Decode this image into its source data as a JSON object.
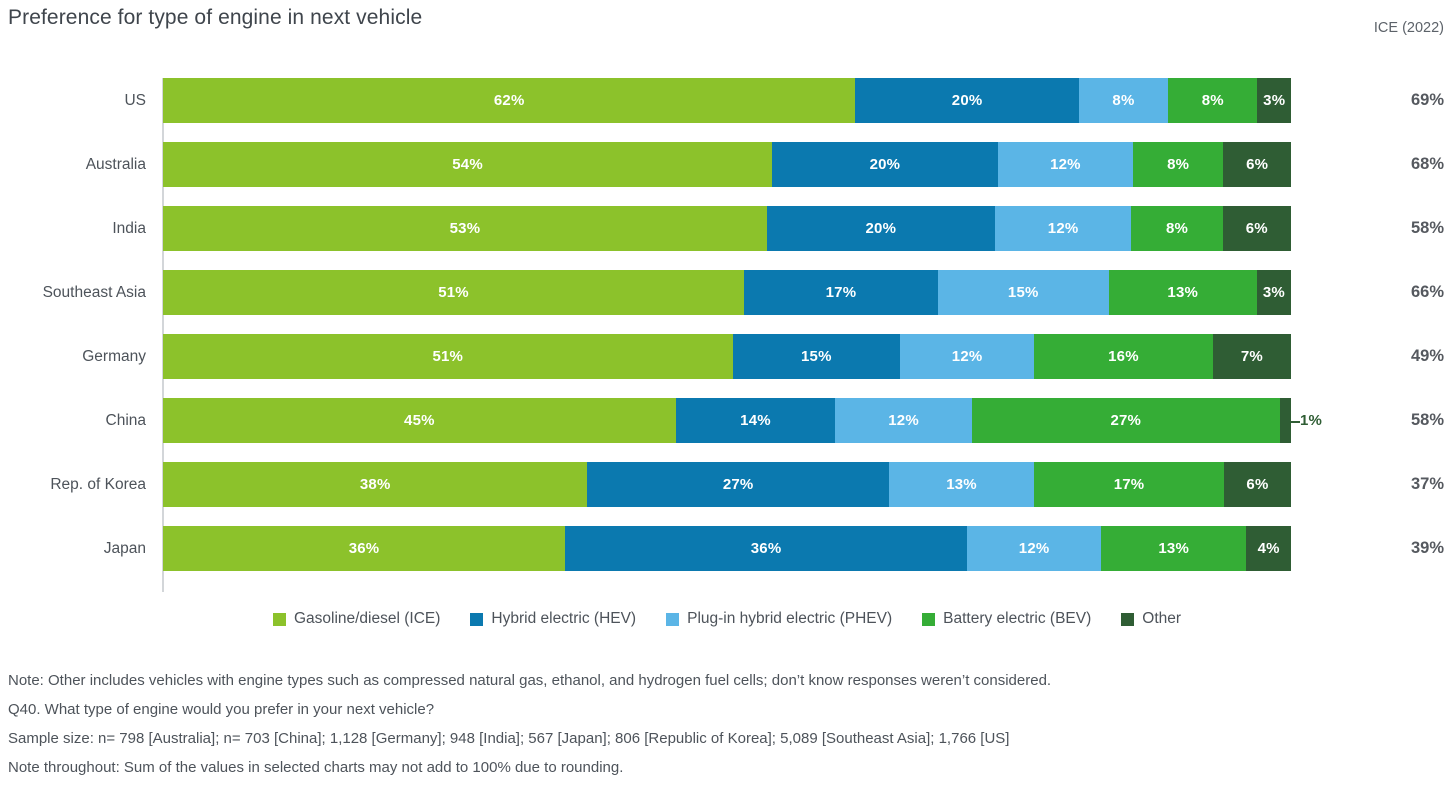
{
  "header": {
    "title": "Preference for type of engine in next vehicle",
    "corner_label": "ICE (2022)"
  },
  "chart_data": {
    "type": "bar",
    "orientation": "horizontal",
    "stacked": true,
    "stack_mode": "percent",
    "title": "Preference for type of engine in next vehicle",
    "xlabel": "",
    "ylabel": "",
    "xlim": [
      0,
      100
    ],
    "grid": false,
    "legend_position": "bottom",
    "value_suffix": "%",
    "categories": [
      "US",
      "Australia",
      "India",
      "Southeast Asia",
      "Germany",
      "China",
      "Rep. of Korea",
      "Japan"
    ],
    "series": [
      {
        "name": "Gasoline/diesel (ICE)",
        "color": "#8CC22B",
        "values": [
          62,
          54,
          53,
          51,
          51,
          45,
          38,
          36
        ]
      },
      {
        "name": "Hybrid electric (HEV)",
        "color": "#0B79AF",
        "values": [
          20,
          20,
          20,
          17,
          15,
          14,
          27,
          36
        ]
      },
      {
        "name": "Plug-in hybrid electric (PHEV)",
        "color": "#5BB5E6",
        "values": [
          8,
          12,
          12,
          15,
          12,
          12,
          13,
          12
        ]
      },
      {
        "name": "Battery electric (BEV)",
        "color": "#35AD36",
        "values": [
          8,
          8,
          8,
          13,
          16,
          27,
          17,
          13
        ]
      },
      {
        "name": "Other",
        "color": "#2F5D34",
        "values": [
          3,
          6,
          6,
          3,
          7,
          1,
          6,
          4
        ]
      }
    ],
    "row_totals_header": "ICE (2022)",
    "row_totals": [
      "69%",
      "68%",
      "58%",
      "66%",
      "49%",
      "58%",
      "37%",
      "39%"
    ],
    "callouts": [
      {
        "category": "China",
        "series": "Other",
        "value": 1,
        "label": "1%",
        "style": "leader-line-outside"
      }
    ]
  },
  "legend": [
    {
      "label": "Gasoline/diesel (ICE)",
      "color": "#8CC22B"
    },
    {
      "label": "Hybrid electric (HEV)",
      "color": "#0B79AF"
    },
    {
      "label": "Plug-in hybrid electric (PHEV)",
      "color": "#5BB5E6"
    },
    {
      "label": "Battery electric (BEV)",
      "color": "#35AD36"
    },
    {
      "label": "Other",
      "color": "#2F5D34"
    }
  ],
  "notes": [
    "Note: Other includes vehicles with engine types such as compressed natural gas, ethanol, and hydrogen fuel cells; don’t know responses weren’t considered.",
    "Q40. What type of engine would you prefer in your next vehicle?",
    "Sample size: n= 798 [Australia]; n= 703 [China]; 1,128 [Germany]; 948 [India]; 567 [Japan]; 806 [Republic of Korea]; 5,089 [Southeast Asia]; 1,766 [US]",
    "Note throughout: Sum of the values in selected charts may not add to 100% due to rounding."
  ]
}
